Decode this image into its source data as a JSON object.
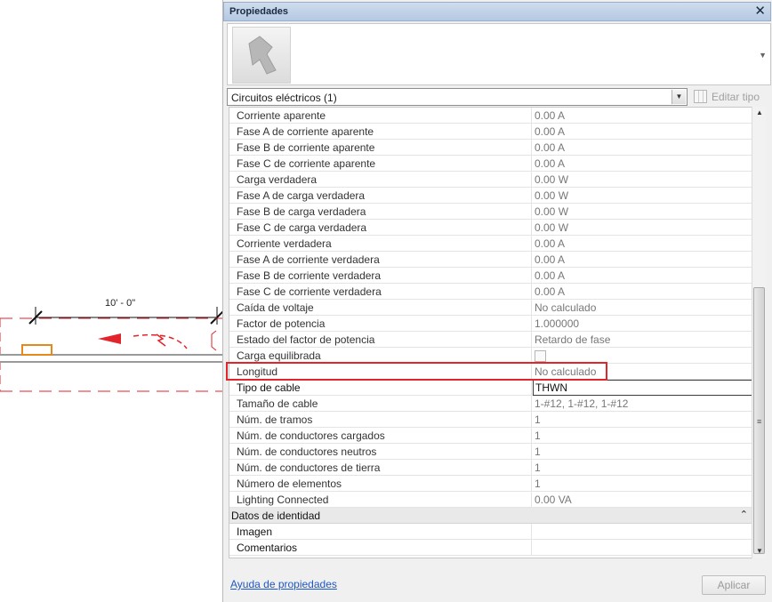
{
  "canvas": {
    "dimension_label": "10' - 0\""
  },
  "palette": {
    "title": "Propiedades",
    "close_glyph": "✕",
    "type_selector": "Circuitos eléctricos (1)",
    "edit_type_label": "Editar tipo",
    "help_link": "Ayuda de propiedades",
    "apply_label": "Aplicar"
  },
  "properties": [
    {
      "name": "Corriente aparente",
      "value": "0.00 A"
    },
    {
      "name": "Fase A de corriente aparente",
      "value": "0.00 A"
    },
    {
      "name": "Fase B de corriente aparente",
      "value": "0.00 A"
    },
    {
      "name": "Fase C de corriente aparente",
      "value": "0.00 A"
    },
    {
      "name": "Carga verdadera",
      "value": "0.00 W"
    },
    {
      "name": "Fase A de carga verdadera",
      "value": "0.00 W"
    },
    {
      "name": "Fase B de carga verdadera",
      "value": "0.00 W"
    },
    {
      "name": "Fase C de carga verdadera",
      "value": "0.00 W"
    },
    {
      "name": "Corriente verdadera",
      "value": "0.00 A"
    },
    {
      "name": "Fase A de corriente verdadera",
      "value": "0.00 A"
    },
    {
      "name": "Fase B de corriente verdadera",
      "value": "0.00 A"
    },
    {
      "name": "Fase C de corriente verdadera",
      "value": "0.00 A"
    },
    {
      "name": "Caída de voltaje",
      "value": "No calculado"
    },
    {
      "name": "Factor de potencia",
      "value": "1.000000"
    },
    {
      "name": "Estado del factor de potencia",
      "value": "Retardo de fase"
    },
    {
      "name": "Carga equilibrada",
      "value": ""
    },
    {
      "name": "Longitud",
      "value": "No calculado"
    },
    {
      "name": "Tipo de cable",
      "value": "THWN"
    },
    {
      "name": "Tamaño de cable",
      "value": "1-#12, 1-#12, 1-#12"
    },
    {
      "name": "Núm. de tramos",
      "value": "1"
    },
    {
      "name": "Núm. de conductores cargados",
      "value": "1"
    },
    {
      "name": "Núm. de conductores neutros",
      "value": "1"
    },
    {
      "name": "Núm. de conductores de tierra",
      "value": "1"
    },
    {
      "name": "Número de elementos",
      "value": "1"
    },
    {
      "name": "Lighting Connected",
      "value": "0.00 VA"
    }
  ],
  "identity_group": {
    "title": "Datos de identidad",
    "rows": [
      {
        "name": "Imagen",
        "value": ""
      },
      {
        "name": "Comentarios",
        "value": ""
      }
    ]
  },
  "colors": {
    "highlight": "#e2242b",
    "circuit_red": "#e2242b",
    "device_orange": "#e58a1a",
    "link_blue": "#1f57c2"
  }
}
